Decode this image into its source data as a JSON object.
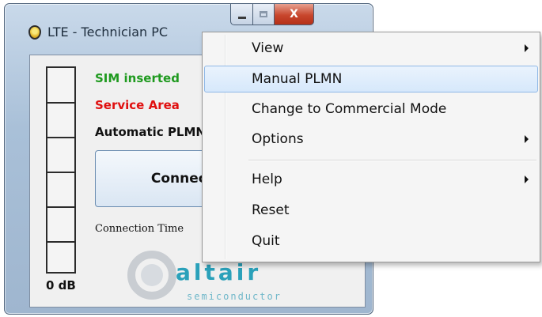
{
  "window": {
    "title": "LTE - Technician PC",
    "close_glyph": "X"
  },
  "status": {
    "sim": "SIM inserted",
    "service": "Service Area",
    "plmn": "Automatic PLMN",
    "colors": {
      "sim": "#1f9a1f",
      "service": "#e01010",
      "plmn": "#111111"
    }
  },
  "signal": {
    "label": "0 dB",
    "level": 0
  },
  "connect_button": {
    "label": "Connect"
  },
  "connection_time": {
    "label": "Connection Time"
  },
  "logo": {
    "word": "altair",
    "sub": "semiconductor"
  },
  "menu": {
    "items": [
      {
        "label": "View",
        "submenu": true
      },
      {
        "label": "Manual PLMN",
        "submenu": false,
        "highlighted": true
      },
      {
        "label": "Change to Commercial Mode",
        "submenu": false
      },
      {
        "label": "Options",
        "submenu": true
      },
      {
        "label": "Help",
        "submenu": true
      },
      {
        "label": "Reset",
        "submenu": false
      },
      {
        "label": "Quit",
        "submenu": false
      }
    ],
    "highlight_color": "#d6e8fb"
  }
}
